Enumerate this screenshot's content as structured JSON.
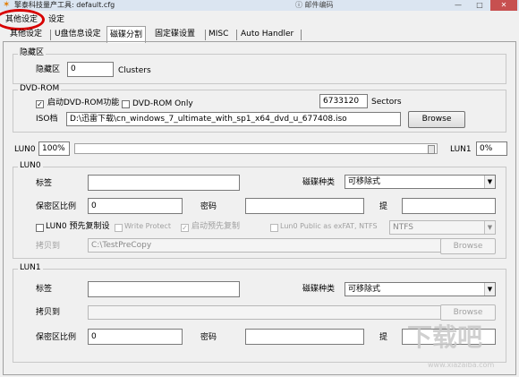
{
  "window": {
    "title": "擎泰科技量产工具: default.cfg",
    "right_text": "ⓘ 邮件编码",
    "minimize": "—",
    "maximize": "□",
    "close": "✕"
  },
  "menu": {
    "item_1": "其他设定",
    "item_2": "设定"
  },
  "tabs": [
    "其他设定",
    "U盘信息设定",
    "磁碟分割",
    "固定碟设置",
    "MISC",
    "Auto Handler"
  ],
  "hidden_area": {
    "legend": "隐藏区",
    "label": "隐藏区",
    "value": "0",
    "unit": "Clusters"
  },
  "dvd_rom": {
    "legend": "DVD-ROM",
    "enable_label": "启动DVD-ROM功能",
    "enable_checked": true,
    "only_label": "DVD-ROM Only",
    "only_checked": false,
    "sectors_value": "6733120",
    "sectors_unit": "Sectors",
    "iso_label": "ISO档",
    "iso_path": "D:\\迅雷下载\\cn_windows_7_ultimate_with_sp1_x64_dvd_u_677408.iso",
    "browse": "Browse"
  },
  "split": {
    "lun0_label": "LUN0",
    "lun0_percent": "100%",
    "lun1_label": "LUN1",
    "lun1_percent": "0%"
  },
  "lun0": {
    "legend": "LUN0",
    "tag_label": "标签",
    "tag_value": "",
    "disk_type_label": "磁碟种类",
    "disk_type_value": "可移除式",
    "secure_ratio_label": "保密区比例",
    "secure_ratio_value": "0",
    "password_label": "密码",
    "password_value": "",
    "hint_label": "提",
    "hint_value": "",
    "precopy_label": "LUN0 预先复制设",
    "precopy_checked": false,
    "write_protect_label": "Write Protect",
    "write_protect_checked": false,
    "start_precopy_label": "启动预先复制",
    "start_precopy_checked": true,
    "public_label": "Lun0 Public as exFAT, NTFS",
    "public_checked": false,
    "fs_value": "NTFS",
    "copy_to_label": "拷贝到",
    "copy_to_value": "C:\\TestPreCopy",
    "browse": "Browse"
  },
  "lun1": {
    "legend": "LUN1",
    "tag_label": "标签",
    "tag_value": "",
    "disk_type_label": "磁碟种类",
    "disk_type_value": "可移除式",
    "copy_to_label": "拷贝到",
    "copy_to_value": "",
    "browse": "Browse",
    "secure_ratio_label": "保密区比例",
    "secure_ratio_value": "0",
    "password_label": "密码",
    "password_value": "",
    "hint_label": "提",
    "hint_value": ""
  },
  "watermark": {
    "logo_text": "下载吧",
    "url": "www.xiazaiba.com"
  },
  "colors": {
    "highlight_circle": "#d80000",
    "titlebar": "#dbe5f1"
  }
}
